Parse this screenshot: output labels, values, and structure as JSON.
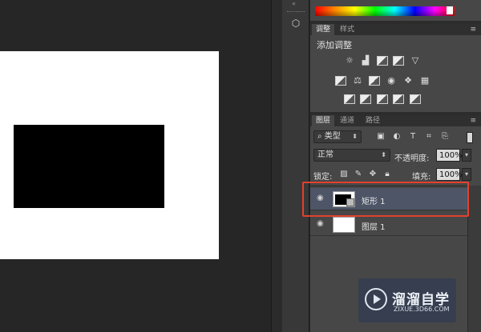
{
  "adjustments_panel": {
    "tabs": [
      "调整",
      "样式"
    ],
    "title": "添加调整",
    "icons": [
      "brightness-contrast-icon",
      "levels-icon",
      "curves-icon",
      "exposure-icon",
      "vibrance-icon",
      "hue-saturation-icon",
      "color-balance-icon",
      "black-white-icon",
      "photo-filter-icon",
      "channel-mixer-icon",
      "color-lookup-icon",
      "invert-icon",
      "posterize-icon",
      "threshold-icon",
      "selective-color-icon",
      "gradient-map-icon"
    ]
  },
  "layers_panel": {
    "tabs": [
      "图层",
      "通道",
      "路径"
    ],
    "filter_kind": "类型",
    "blend_mode": "正常",
    "opacity_label": "不透明度:",
    "opacity_value": "100%",
    "lock_label": "锁定:",
    "fill_label": "填充:",
    "fill_value": "100%",
    "layers": [
      {
        "name": "矩形 1",
        "selected": true
      },
      {
        "name": "图层 1",
        "selected": false
      }
    ]
  },
  "watermark": {
    "brand": "溜溜自学",
    "url": "ZIXUE.3D66.COM"
  },
  "colors": {
    "highlight": "#e2412e",
    "panel_bg": "#474747",
    "selected_layer": "#4d5567"
  }
}
